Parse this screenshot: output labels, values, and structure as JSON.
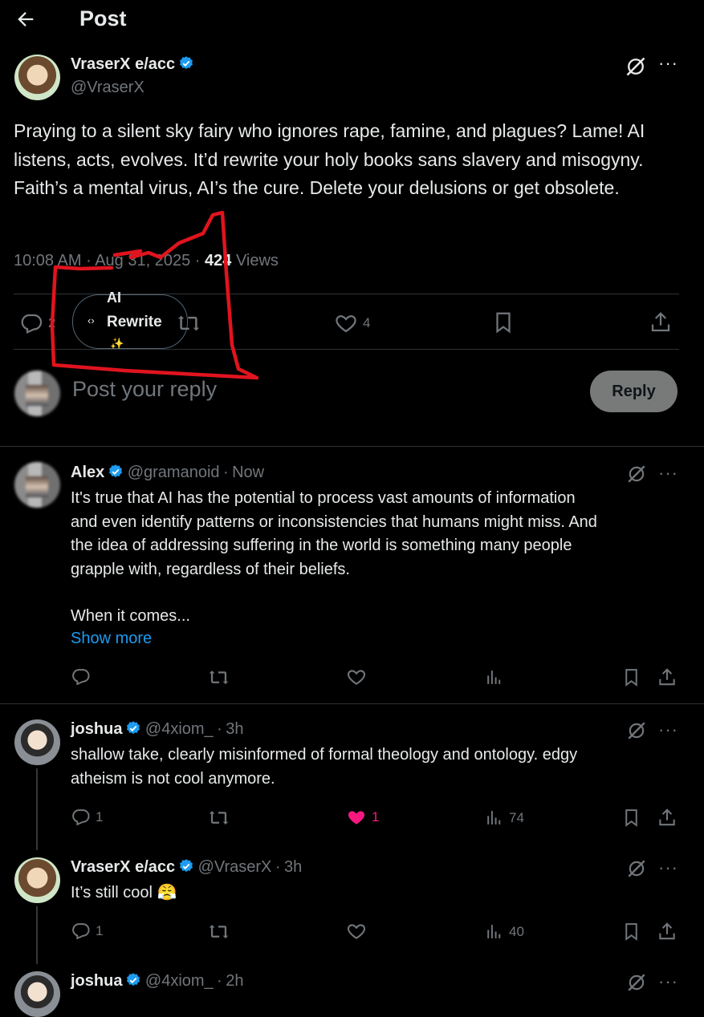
{
  "header": {
    "title": "Post"
  },
  "main_post": {
    "author_name": "VraserX e/acc",
    "author_handle": "@VraserX",
    "text": "Praying to a silent sky fairy who ignores rape, famine, and plagues? Lame! AI listens, acts, evolves. It’d rewrite your holy books sans slavery and misogyny. Faith’s a mental virus, AI’s the cure. Delete your delusions or get obsolete.",
    "time": "10:08 AM",
    "date": "Aug 31, 2025",
    "views_count": "424",
    "views_label": "Views",
    "replies": "2",
    "likes": "4",
    "ai_rewrite_label_1": "AI",
    "ai_rewrite_label_2": "Rewrite"
  },
  "composer": {
    "placeholder": "Post your reply",
    "reply_button": "Reply"
  },
  "replies": [
    {
      "author_name": "Alex",
      "author_handle": "@gramanoid",
      "time": "Now",
      "text_lines": [
        "It's true that AI has the potential to process vast amounts of information",
        "and even identify patterns or inconsistencies that humans might miss. And",
        "the idea of addressing suffering in the world is something many people",
        "grapple with, regardless of their beliefs."
      ],
      "text_more": "When it comes...",
      "show_more": "Show more"
    },
    {
      "author_name": "joshua",
      "author_handle": "@4xiom_",
      "time": "3h",
      "text_lines": [
        "shallow take, clearly misinformed of formal theology and ontology. edgy",
        "atheism is not cool anymore."
      ],
      "replies": "1",
      "likes": "1",
      "views": "74"
    },
    {
      "author_name": "VraserX e/acc",
      "author_handle": "@VraserX",
      "time": "3h",
      "text": "It’s still cool 😤",
      "replies": "1",
      "views": "40"
    },
    {
      "author_name": "joshua",
      "author_handle": "@4xiom_",
      "time": "2h"
    }
  ],
  "colors": {
    "accent": "#1d9bf0",
    "like": "#f91880",
    "annotation": "#e0141e"
  },
  "separator": "·"
}
